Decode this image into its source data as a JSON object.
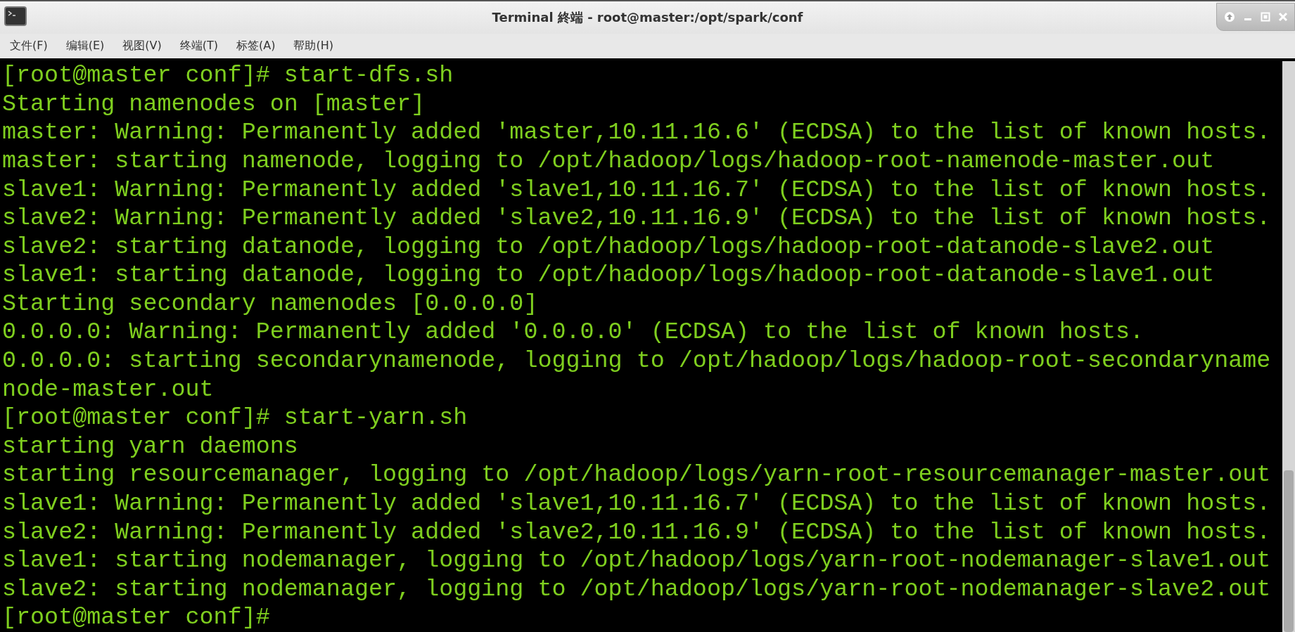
{
  "window": {
    "title": "Terminal 終端 - root@master:/opt/spark/conf"
  },
  "menu": [
    "文件(F)",
    "编辑(E)",
    "视图(V)",
    "终端(T)",
    "标签(A)",
    "帮助(H)"
  ],
  "terminal": {
    "lines": [
      "[root@master conf]# start-dfs.sh",
      "Starting namenodes on [master]",
      "master: Warning: Permanently added 'master,10.11.16.6' (ECDSA) to the list of known hosts.",
      "master: starting namenode, logging to /opt/hadoop/logs/hadoop-root-namenode-master.out",
      "slave1: Warning: Permanently added 'slave1,10.11.16.7' (ECDSA) to the list of known hosts.",
      "slave2: Warning: Permanently added 'slave2,10.11.16.9' (ECDSA) to the list of known hosts.",
      "slave2: starting datanode, logging to /opt/hadoop/logs/hadoop-root-datanode-slave2.out",
      "slave1: starting datanode, logging to /opt/hadoop/logs/hadoop-root-datanode-slave1.out",
      "Starting secondary namenodes [0.0.0.0]",
      "0.0.0.0: Warning: Permanently added '0.0.0.0' (ECDSA) to the list of known hosts.",
      "0.0.0.0: starting secondarynamenode, logging to /opt/hadoop/logs/hadoop-root-secondaryname",
      "node-master.out",
      "[root@master conf]# start-yarn.sh",
      "starting yarn daemons",
      "starting resourcemanager, logging to /opt/hadoop/logs/yarn-root-resourcemanager-master.out",
      "slave1: Warning: Permanently added 'slave1,10.11.16.7' (ECDSA) to the list of known hosts.",
      "slave2: Warning: Permanently added 'slave2,10.11.16.9' (ECDSA) to the list of known hosts.",
      "slave1: starting nodemanager, logging to /opt/hadoop/logs/yarn-root-nodemanager-slave1.out",
      "slave2: starting nodemanager, logging to /opt/hadoop/logs/yarn-root-nodemanager-slave2.out",
      "[root@master conf]#"
    ]
  }
}
